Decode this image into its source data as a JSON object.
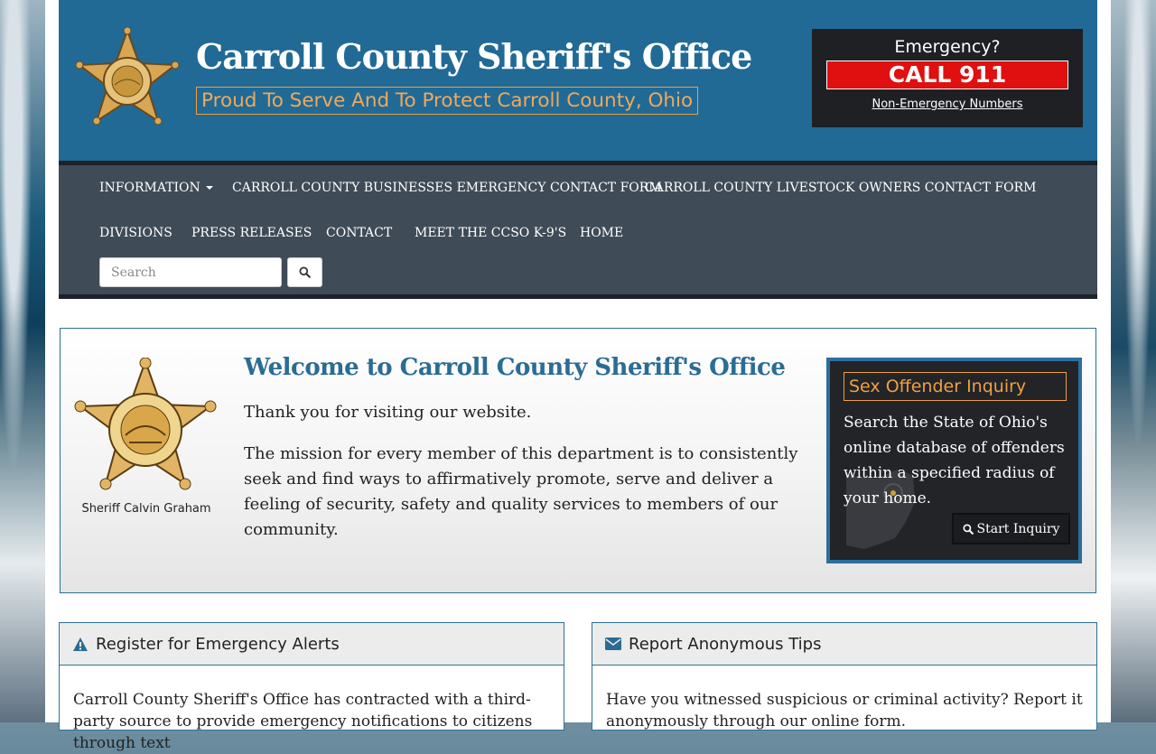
{
  "header": {
    "title": "Carroll County Sheriff's Office",
    "tagline": "Proud To Serve And To Protect Carroll County, Ohio",
    "emergency": {
      "question": "Emergency?",
      "call": "CALL 911",
      "non_emergency_link": "Non-Emergency Numbers"
    }
  },
  "nav": {
    "items": [
      {
        "label": "INFORMATION",
        "has_dropdown": true
      },
      {
        "label": "CARROLL COUNTY BUSINESSES EMERGENCY CONTACT FORM"
      },
      {
        "label": "CARROLL COUNTY LIVESTOCK OWNERS CONTACT FORM"
      },
      {
        "label": "DIVISIONS"
      },
      {
        "label": "PRESS RELEASES"
      },
      {
        "label": "CONTACT"
      },
      {
        "label": "MEET THE CCSO K-9'S"
      },
      {
        "label": "HOME"
      }
    ],
    "search_placeholder": "Search"
  },
  "welcome": {
    "sheriff_name": "Sheriff Calvin Graham",
    "title": "Welcome to Carroll County Sheriff's Office",
    "p1": "Thank you for visiting our website.",
    "p2": "The mission for every member of this department is to consistently seek and find ways to affirmatively promote, serve and deliver a feeling of security, safety and quality services to members of our community."
  },
  "offender": {
    "title": "Sex Offender Inquiry",
    "text": "Search the State of Ohio's online database of offenders within a specified radius of your home.",
    "button": "Start Inquiry"
  },
  "panels": {
    "alerts": {
      "title": "Register for Emergency Alerts",
      "body": "Carroll County Sheriff's Office has contracted with a third-party source to provide emergency notifications to citizens through text"
    },
    "tips": {
      "title": "Report Anonymous Tips",
      "body": "Have you witnessed suspicious or criminal activity? Report it anonymously through our online form."
    }
  },
  "colors": {
    "header_blue": "#216a96",
    "nav_gray": "#3f4b57",
    "accent_orange": "#f0a040",
    "emergency_red": "#e01010",
    "title_blue": "#2a6c94"
  },
  "icons": [
    "sheriff-star-logo",
    "search-icon",
    "warning-icon",
    "envelope-icon",
    "ohio-map-icon"
  ]
}
